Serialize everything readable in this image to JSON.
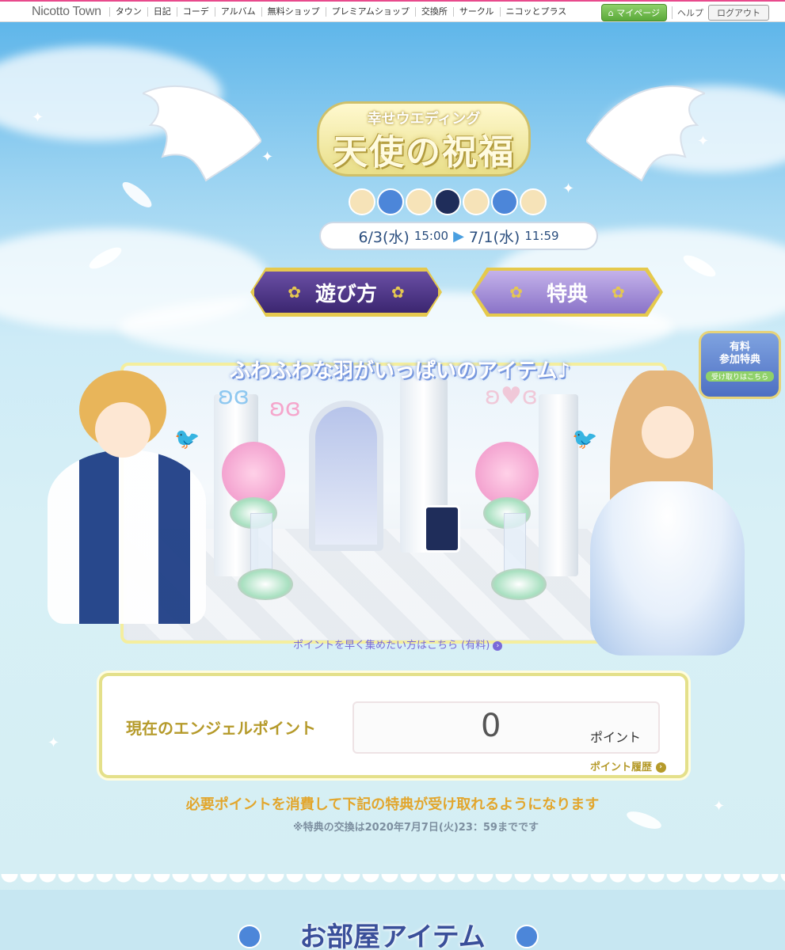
{
  "nav": {
    "logo": "Nicotto Town",
    "links": [
      "タウン",
      "日記",
      "コーデ",
      "アルバム",
      "無料ショップ",
      "プレミアムショップ",
      "交換所",
      "サークル",
      "ニコッとプラス"
    ],
    "mypage": "マイページ",
    "help": "ヘルプ",
    "logout": "ログアウト"
  },
  "event": {
    "subtitle": "幸せウエディング",
    "title": "天使の祝福",
    "start_date": "6/3(水)",
    "start_time": "15:00",
    "end_date": "7/1(水)",
    "end_time": "11:59",
    "howto_label": "遊び方",
    "bonus_label": "特典",
    "paid_badge_line1": "有料",
    "paid_badge_line2": "参加特典",
    "paid_badge_sub": "受け取りはこちら",
    "scene_title": "ふわふわな羽がいっぱいのアイテム♪",
    "paid_link": "ポイントを早く集めたい方はこちら (有料)"
  },
  "points": {
    "label": "現在のエンジェルポイント",
    "value": "0",
    "unit": "ポイント",
    "history": "ポイント履歴"
  },
  "notice": {
    "main": "必要ポイントを消費して下記の特典が受け取れるようになります",
    "sub": "※特典の交換は2020年7月7日(火)23：59までです"
  },
  "section": {
    "title": "お部屋アイテム"
  },
  "colors": {
    "accent_gold": "#b59a2a",
    "notice_orange": "#e2a62d",
    "link_purple": "#7a6ad8",
    "date_blue": "#2b4e7e"
  }
}
